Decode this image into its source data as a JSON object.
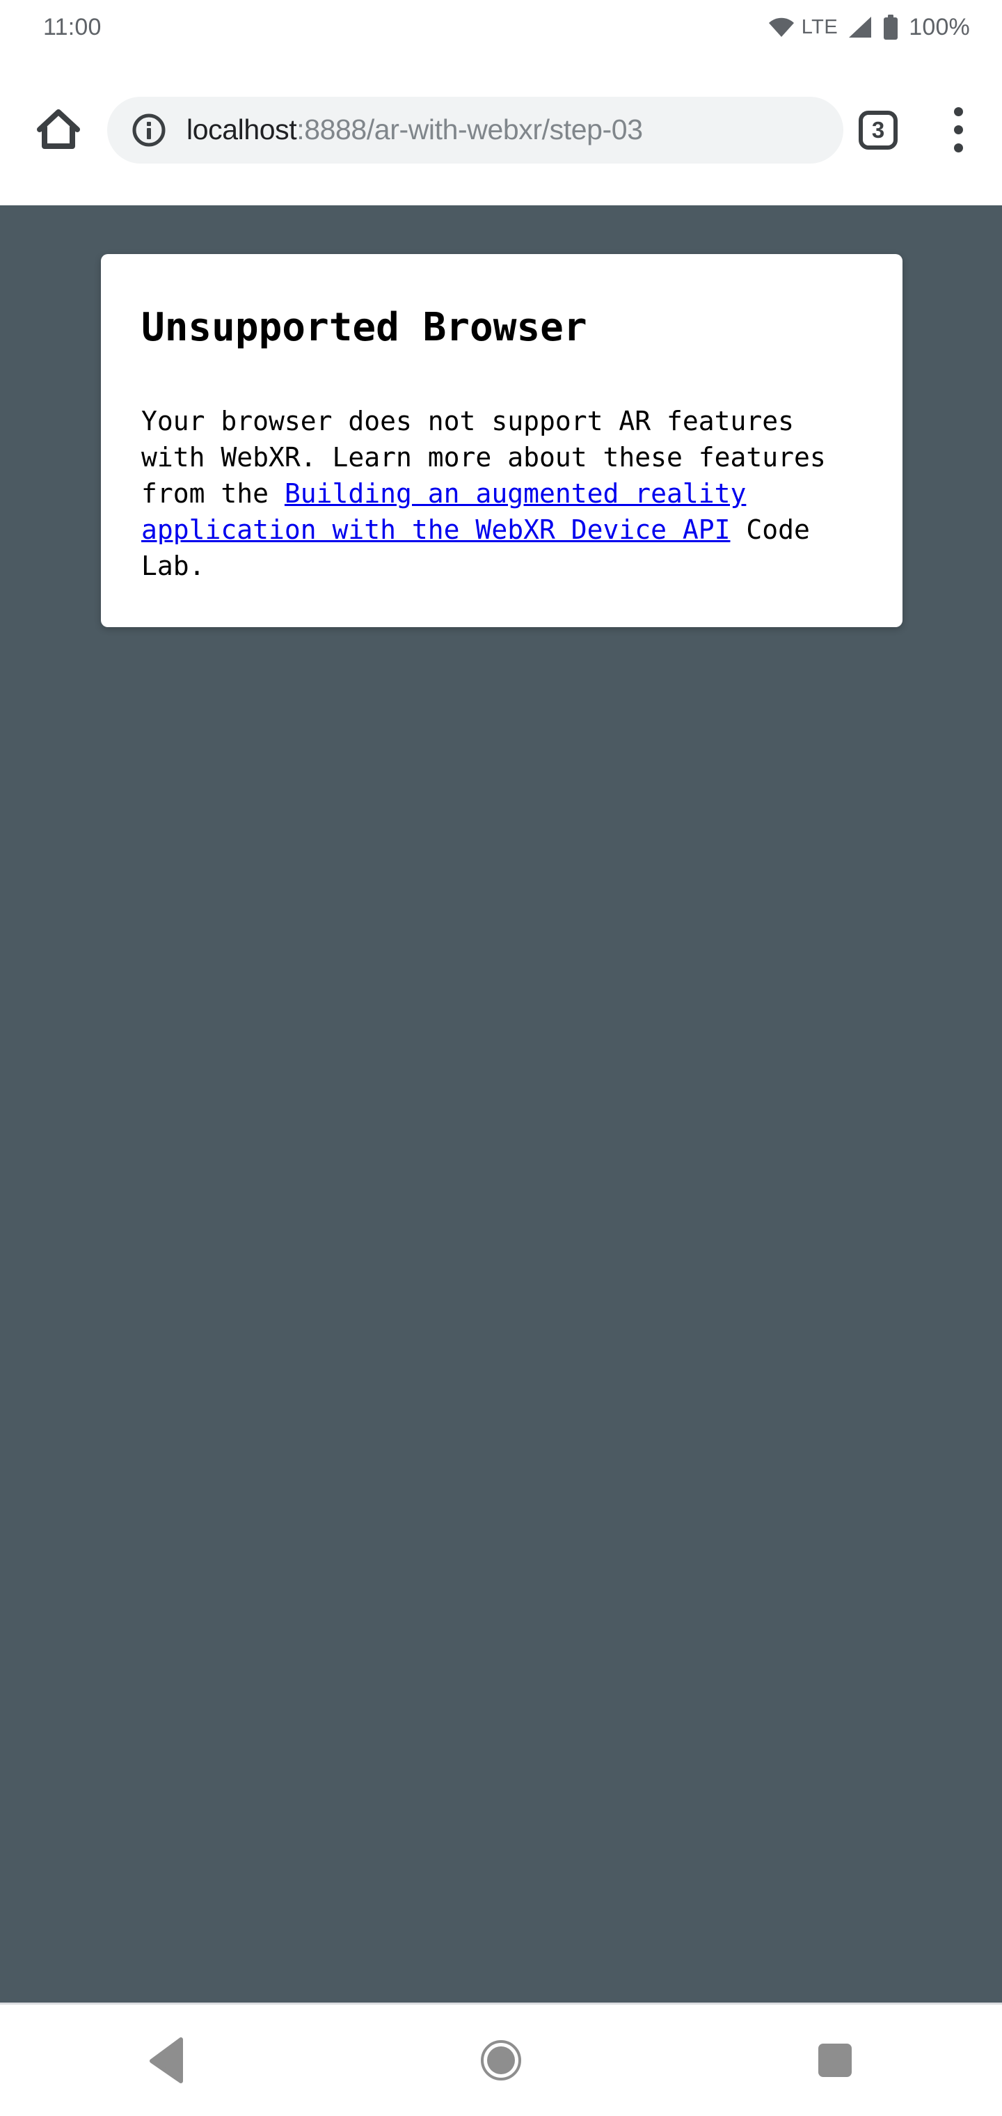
{
  "status_bar": {
    "clock": "11:00",
    "network_label": "LTE",
    "battery_percent": "100%",
    "icons": {
      "wifi": "wifi-icon",
      "signal": "cellular-signal-icon",
      "battery": "battery-icon"
    }
  },
  "browser": {
    "home_icon": "home-icon",
    "site_info_icon": "info-circle-icon",
    "url_prefix": "localhost",
    "url_suffix": ":8888/ar-with-webxr/step-03",
    "url_full": "localhost:8888/ar-with-webxr/step-03",
    "tab_count": "3",
    "overflow_icon": "three-dot-menu-icon"
  },
  "page": {
    "background_color": "#4c5a62",
    "card": {
      "title": "Unsupported Browser",
      "body_before_link": "Your browser does not support AR features with WebXR. Learn more about these features from the ",
      "link_text": "Building an augmented reality application with the WebXR Device API",
      "body_after_link": " Code Lab.",
      "link_color": "#0000ee"
    }
  },
  "nav_bar": {
    "back_icon": "back-triangle-icon",
    "home_icon": "home-circle-icon",
    "recents_icon": "recents-square-icon"
  }
}
